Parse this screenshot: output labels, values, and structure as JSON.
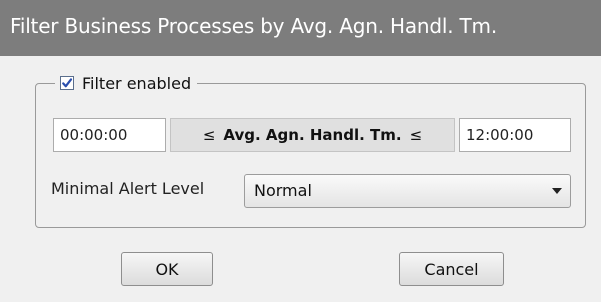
{
  "window": {
    "title": "Filter Business Processes by Avg. Agn. Handl. Tm."
  },
  "filter": {
    "enabled_label": "Filter enabled",
    "enabled": true
  },
  "range": {
    "min_value": "00:00:00",
    "max_value": "12:00:00",
    "less_equal_symbol": "≤",
    "metric_label": "Avg. Agn. Handl. Tm."
  },
  "alert": {
    "label": "Minimal Alert Level",
    "selected": "Normal"
  },
  "buttons": {
    "ok": "OK",
    "cancel": "Cancel"
  },
  "icons": {
    "checkbox_check": "check-icon",
    "dropdown": "chevron-down-icon"
  },
  "colors": {
    "titlebar": "#7d7d7d",
    "dialog_bg": "#f0f0f0",
    "check": "#2b4fae"
  }
}
